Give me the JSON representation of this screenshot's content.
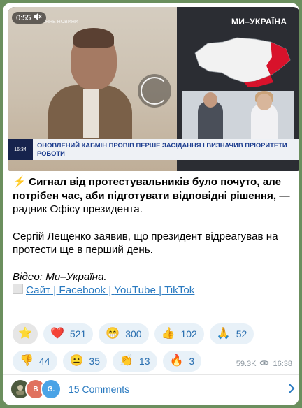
{
  "video": {
    "duration": "0:55",
    "channel_logo": "МИ–УКРАЇНА",
    "small_logo": "ІННЕ НОВИНИ",
    "ticker_time": "16:34",
    "ticker_text": "ОНОВЛЕНИЙ КАБМІН ПРОВІВ ПЕРШЕ ЗАСІДАННЯ І ВИЗНАЧИВ ПРІОРИТЕТИ РОБОТИ"
  },
  "message": {
    "emoji": "⚡",
    "bold_text": "Сигнал від протестувальників було почуто, але потрібен час, аби підготувати відповідні рішення,",
    "after_bold": " — радник Офісу президента.",
    "paragraph2": "Сергій Лещенко заявив, що президент відреагував на протести ще в перший день.",
    "paragraph3": "Відео: Ми–Україна.",
    "links": [
      "Сайт",
      "Facebook",
      "YouTube",
      "TikTok"
    ],
    "link_separator": " | "
  },
  "reactions": [
    {
      "emoji": "⭐",
      "count": ""
    },
    {
      "emoji": "❤️",
      "count": "521"
    },
    {
      "emoji": "😁",
      "count": "300"
    },
    {
      "emoji": "👍",
      "count": "102"
    },
    {
      "emoji": "🙏",
      "count": "52"
    },
    {
      "emoji": "👎",
      "count": "44"
    },
    {
      "emoji": "😐",
      "count": "35"
    },
    {
      "emoji": "👏",
      "count": "13"
    },
    {
      "emoji": "🔥",
      "count": "3"
    }
  ],
  "meta": {
    "views": "59.3K",
    "time": "16:38"
  },
  "comments": {
    "label": "15 Comments",
    "avatars": [
      "",
      "B",
      "G."
    ]
  },
  "colors": {
    "link": "#2a7ac0",
    "reaction_bg": "#e8f1f8",
    "ticker_text": "#1c3d8f"
  }
}
